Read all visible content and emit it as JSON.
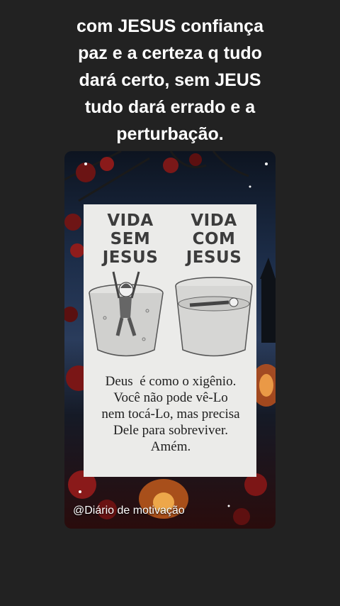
{
  "caption": "com JESUS confiança\npaz e a certeza q tudo\ndará certo, sem JEUS\ntudo dará errado e a\nperturbação.",
  "image": {
    "left_heading": "VIDA\nSEM\nJESUS",
    "right_heading": "VIDA\nCOM\nJESUS",
    "quote_lines": [
      "Deus  é como o xigênio.",
      "Você não pode vê-Lo",
      "nem tocá-Lo, mas precisa",
      "Dele para sobreviver.",
      "Amém."
    ],
    "watermark": "@Diário de motivação"
  },
  "colors": {
    "page_background": "#222222",
    "caption_text": "#ffffff",
    "card_background": "#ebebe9"
  }
}
